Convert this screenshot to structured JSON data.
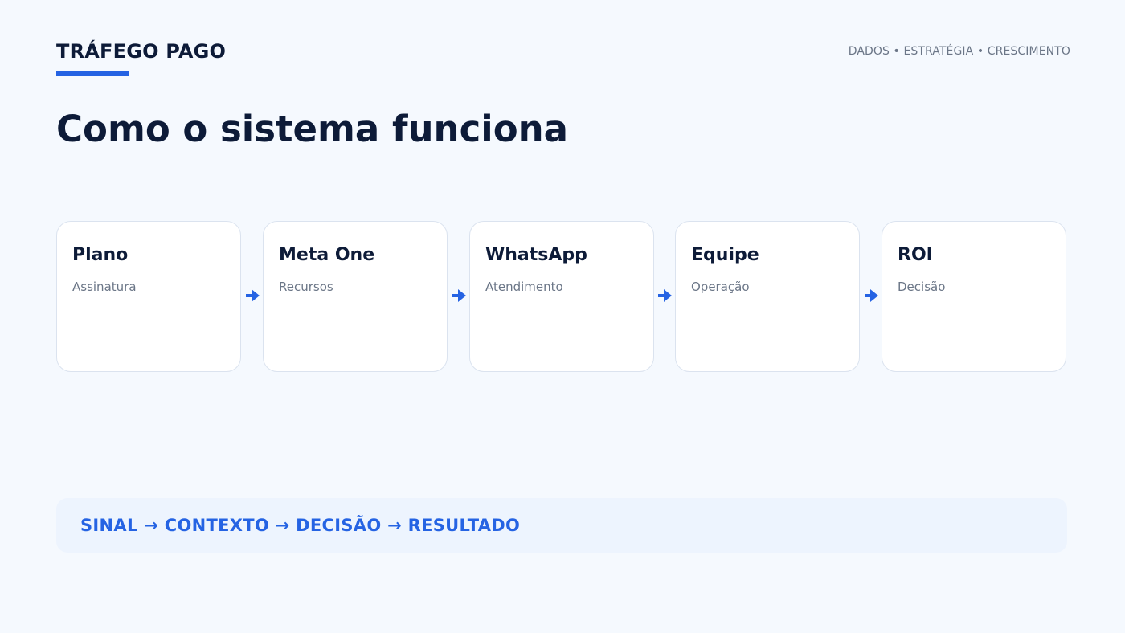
{
  "header": {
    "brand": "TRÁFEGO PAGO",
    "tagline": "DADOS • ESTRATÉGIA • CRESCIMENTO",
    "title": "Como o sistema funciona"
  },
  "flow": {
    "steps": [
      {
        "title": "Plano",
        "subtitle": "Assinatura"
      },
      {
        "title": "Meta One",
        "subtitle": "Recursos"
      },
      {
        "title": "WhatsApp",
        "subtitle": "Atendimento"
      },
      {
        "title": "Equipe",
        "subtitle": "Operação"
      },
      {
        "title": "ROI",
        "subtitle": "Decisão"
      }
    ]
  },
  "summary": {
    "text": "SINAL → CONTEXTO → DECISÃO → RESULTADO"
  },
  "colors": {
    "background": "#f5f9fe",
    "accent": "#2563e3",
    "heading": "#0d1b38",
    "muted": "#6b7687",
    "card_border": "#dbe3ef",
    "summary_background": "#edf4fe"
  },
  "icons": {
    "connector": "arrow-right-icon"
  }
}
